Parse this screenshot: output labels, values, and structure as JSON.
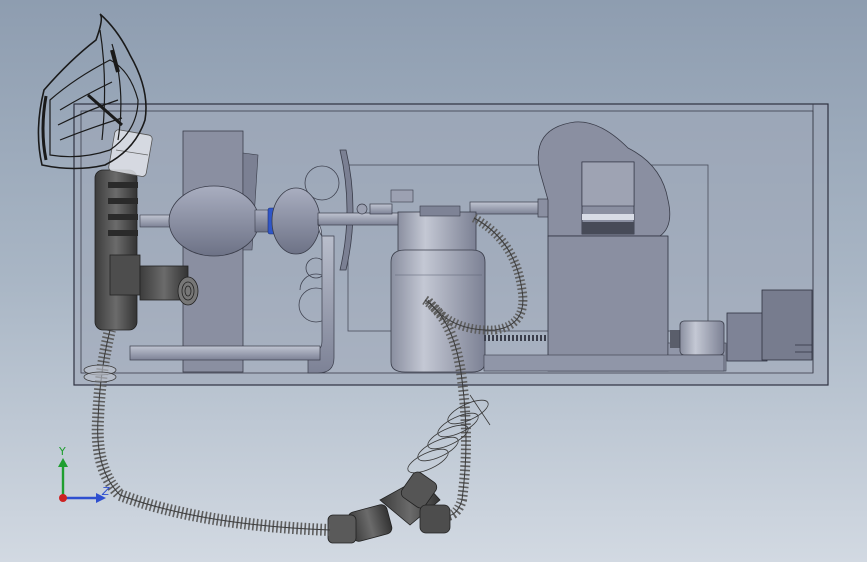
{
  "triad": {
    "y_label": "Y",
    "z_label": "Z",
    "colors": {
      "y": "#1f9e2f",
      "x": "#cc2222",
      "z": "#2f4fd0"
    }
  },
  "colors": {
    "background_top": "#8e9db0",
    "background_bottom": "#d2d9e2",
    "housing": "#9ea6b8",
    "component": "#878c9e",
    "tubing": "#5a5a5a",
    "valve_ring": "#2f56c8"
  },
  "components": [
    "oxygen-mask",
    "breathing-tube",
    "resuscitator-bag",
    "humidifier-bottle",
    "blower-unit",
    "motor",
    "corrugated-hose"
  ]
}
